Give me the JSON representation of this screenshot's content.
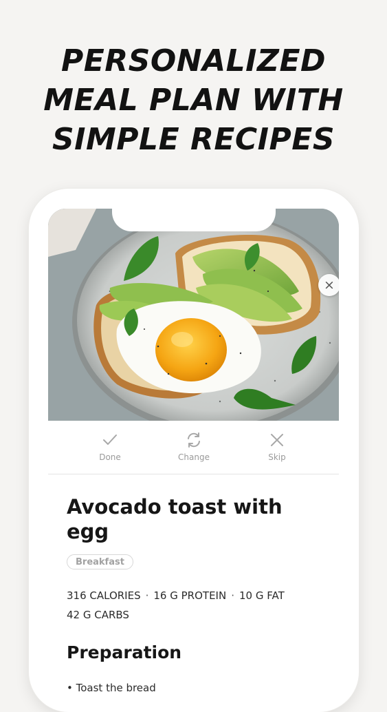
{
  "headline": {
    "line1": "PERSONALIZED",
    "line2": "MEAL PLAN WITH",
    "line3": "SIMPLE RECIPES"
  },
  "photo": {
    "description_icon": "recipe-photo"
  },
  "close_icon": "×",
  "actions": {
    "done": {
      "label": "Done",
      "icon": "check-icon"
    },
    "change": {
      "label": "Change",
      "icon": "refresh-icon"
    },
    "skip": {
      "label": "Skip",
      "icon": "close-icon"
    }
  },
  "recipe": {
    "title": "Avocado toast with egg",
    "tag": "Breakfast",
    "calories": "316 CALORIES",
    "protein": "16 G PROTEIN",
    "fat": "10 G FAT",
    "carbs": "42 G CARBS",
    "separator": "·"
  },
  "preparation": {
    "heading": "Preparation",
    "first_step": "•   Toast the bread"
  },
  "colors": {
    "background": "#f5f4f2",
    "text": "#161616",
    "muted": "#9a9a9a"
  }
}
